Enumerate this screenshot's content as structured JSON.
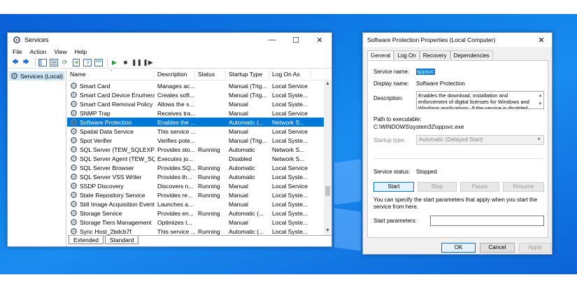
{
  "services_window": {
    "title": "Services",
    "menu": [
      "File",
      "Action",
      "View",
      "Help"
    ],
    "tree_item": "Services (Local)",
    "columns": {
      "name": "Name",
      "description": "Description",
      "status": "Status",
      "startup_type": "Startup Type",
      "log_on_as": "Log On As"
    },
    "rows": [
      {
        "name": "Smart Card",
        "desc": "Manages ac...",
        "status": "",
        "startup": "Manual (Trig...",
        "logon": "Local Service"
      },
      {
        "name": "Smart Card Device Enumera...",
        "desc": "Creates soft...",
        "status": "",
        "startup": "Manual (Trig...",
        "logon": "Local Syste..."
      },
      {
        "name": "Smart Card Removal Policy",
        "desc": "Allows the s...",
        "status": "",
        "startup": "Manual",
        "logon": "Local Syste..."
      },
      {
        "name": "SNMP Trap",
        "desc": "Receives tra...",
        "status": "",
        "startup": "Manual",
        "logon": "Local Service"
      },
      {
        "name": "Software Protection",
        "desc": "Enables the ...",
        "status": "",
        "startup": "Automatic (...",
        "logon": "Network S..."
      },
      {
        "name": "Spatial Data Service",
        "desc": "This service ...",
        "status": "",
        "startup": "Manual",
        "logon": "Local Service"
      },
      {
        "name": "Spot Verifier",
        "desc": "Verifies pote...",
        "status": "",
        "startup": "Manual (Trig...",
        "logon": "Local Syste..."
      },
      {
        "name": "SQL Server (TEW_SQLEXPRE...",
        "desc": "Provides sto...",
        "status": "Running",
        "startup": "Automatic",
        "logon": "Network S..."
      },
      {
        "name": "SQL Server Agent (TEW_SQL...",
        "desc": "Executes jo...",
        "status": "",
        "startup": "Disabled",
        "logon": "Network S..."
      },
      {
        "name": "SQL Server Browser",
        "desc": "Provides SQ...",
        "status": "Running",
        "startup": "Automatic",
        "logon": "Local Service"
      },
      {
        "name": "SQL Server VSS Writer",
        "desc": "Provides th...",
        "status": "Running",
        "startup": "Automatic",
        "logon": "Local Syste..."
      },
      {
        "name": "SSDP Discovery",
        "desc": "Discovers n...",
        "status": "Running",
        "startup": "Manual",
        "logon": "Local Service"
      },
      {
        "name": "State Repository Service",
        "desc": "Provides re...",
        "status": "Running",
        "startup": "Manual",
        "logon": "Local Syste..."
      },
      {
        "name": "Still Image Acquisition Events",
        "desc": "Launches a...",
        "status": "",
        "startup": "Manual",
        "logon": "Local Syste..."
      },
      {
        "name": "Storage Service",
        "desc": "Provides en...",
        "status": "Running",
        "startup": "Automatic (...",
        "logon": "Local Syste..."
      },
      {
        "name": "Storage Tiers Management",
        "desc": "Optimizes t...",
        "status": "",
        "startup": "Manual",
        "logon": "Local Syste..."
      },
      {
        "name": "Sync Host_2bdcb7f",
        "desc": "This service ...",
        "status": "Running",
        "startup": "Automatic (...",
        "logon": "Local Syste..."
      }
    ],
    "selected_row": 4,
    "bottom_tabs": [
      "Extended",
      "Standard"
    ]
  },
  "properties_dialog": {
    "title": "Software Protection Properties (Local Computer)",
    "tabs": [
      "General",
      "Log On",
      "Recovery",
      "Dependencies"
    ],
    "service_name_label": "Service name:",
    "service_name_value": "sppsvc",
    "display_name_label": "Display name:",
    "display_name_value": "Software Protection",
    "description_label": "Description:",
    "description_value": "Enables the download, installation and enforcement of digital licenses for Windows and Windows applications. If the service is disabled, the operating",
    "path_label": "Path to executable:",
    "path_value": "C:\\WINDOWS\\system32\\sppsvc.exe",
    "startup_type_label": "Startup type:",
    "startup_type_value": "Automatic (Delayed Start)",
    "service_status_label": "Service status:",
    "service_status_value": "Stopped",
    "buttons": {
      "start": "Start",
      "stop": "Stop",
      "pause": "Pause",
      "resume": "Resume"
    },
    "help_text": "You can specify the start parameters that apply when you start the service from here.",
    "start_params_label": "Start parameters:",
    "start_params_value": "",
    "footer": {
      "ok": "OK",
      "cancel": "Cancel",
      "apply": "Apply"
    }
  }
}
